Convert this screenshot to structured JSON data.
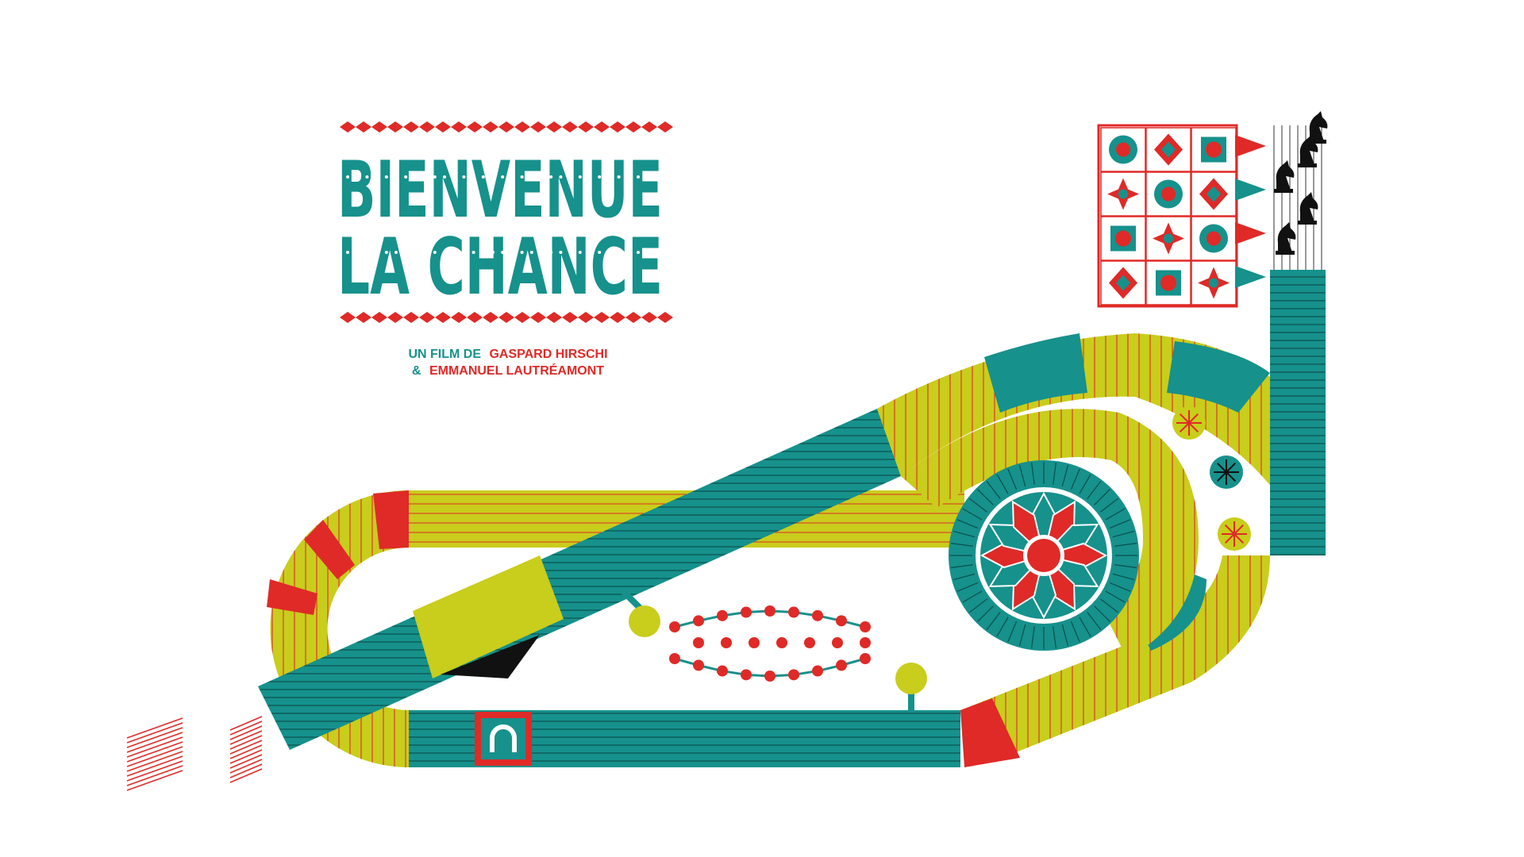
{
  "title": {
    "line1": "BIENVENUE",
    "line2": "LA CHANCE"
  },
  "credits": {
    "line1_prefix": "UN FILM DE",
    "line1_name": "GASPARD HIRSCHI",
    "line2_prefix": "&",
    "line2_name": "EMMANUEL LAUTRÉAMONT"
  },
  "colors": {
    "teal": "#16918c",
    "red": "#df2a27",
    "yellow": "#c9cd1c",
    "black": "#111111",
    "background": "#ffffff"
  },
  "icons": {
    "grid": [
      "clover-icon",
      "dice-icon",
      "horse-head-icon",
      "shield-icon",
      "medal-icon",
      "diamond-icon",
      "wheel-icon",
      "star-icon",
      "cross-icon",
      "compass-star-icon",
      "horseshoe-icon",
      "target-icon"
    ],
    "flags": [
      "pennant-icon",
      "pennant-icon",
      "pennant-icon",
      "pennant-icon"
    ],
    "knights": [
      "chess-knight-icon",
      "chess-knight-icon",
      "chess-knight-icon",
      "chess-knight-icon",
      "chess-knight-icon"
    ],
    "track_badge": "horseshoe-icon"
  }
}
